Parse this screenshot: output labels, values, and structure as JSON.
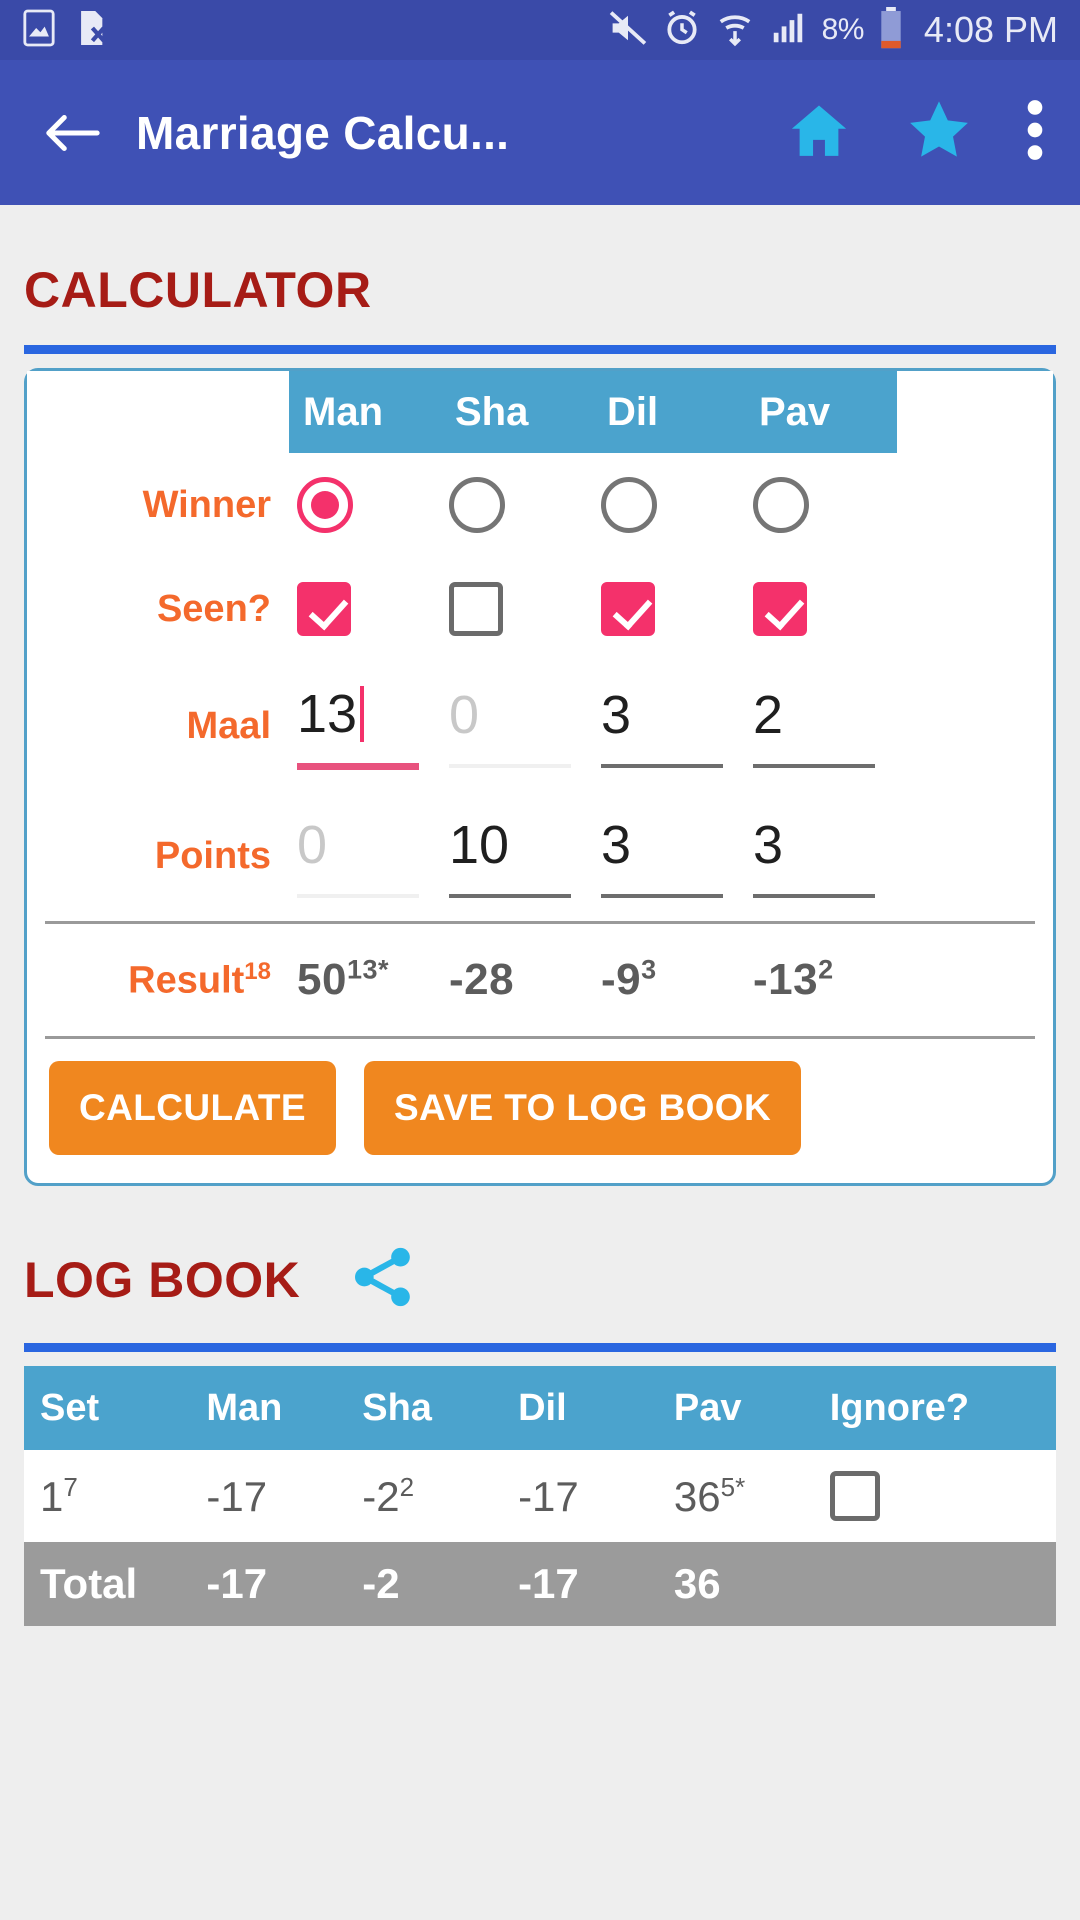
{
  "statusbar": {
    "battery_percent": "8%",
    "time": "4:08 PM",
    "icons": [
      "image-icon",
      "sim-card-error-icon",
      "mute-icon",
      "alarm-icon",
      "wifi-icon",
      "signal-icon",
      "battery-icon"
    ]
  },
  "appbar": {
    "title": "Marriage Calcu...",
    "back_icon": "back-arrow-icon",
    "home_icon": "home-icon",
    "star_icon": "star-icon",
    "overflow_icon": "more-vert-icon"
  },
  "calculator": {
    "heading": "CALCULATOR",
    "columns": [
      "Man",
      "Sha",
      "Dil",
      "Pav"
    ],
    "rows": {
      "winner": {
        "label": "Winner",
        "selected_index": 0,
        "values": [
          true,
          false,
          false,
          false
        ]
      },
      "seen": {
        "label": "Seen?",
        "values": [
          true,
          false,
          true,
          true
        ]
      },
      "maal": {
        "label": "Maal",
        "values": [
          "13",
          "",
          "3",
          "2"
        ],
        "placeholders": [
          "0",
          "0",
          "0",
          "0"
        ],
        "focused_index": 0
      },
      "points": {
        "label": "Points",
        "values": [
          "",
          "10",
          "3",
          "3"
        ],
        "placeholders": [
          "0",
          "0",
          "0",
          "0"
        ],
        "focused_index": -1
      },
      "result": {
        "label": "Result",
        "label_sup": "18",
        "values": [
          {
            "main": "50",
            "sup": "13*"
          },
          {
            "main": "-28",
            "sup": ""
          },
          {
            "main": "-9",
            "sup": "3"
          },
          {
            "main": "-13",
            "sup": "2"
          }
        ]
      }
    },
    "calculate_button": "CALCULATE",
    "save_button": "SAVE TO LOG BOOK"
  },
  "logbook": {
    "heading": "LOG BOOK",
    "share_icon": "share-icon",
    "columns": [
      "Set",
      "Man",
      "Sha",
      "Dil",
      "Pav",
      "Ignore?"
    ],
    "rows": [
      {
        "set": {
          "main": "1",
          "sup": "7"
        },
        "cells": [
          {
            "main": "-17",
            "sup": ""
          },
          {
            "main": "-2",
            "sup": "2"
          },
          {
            "main": "-17",
            "sup": ""
          },
          {
            "main": "36",
            "sup": "5*"
          }
        ],
        "ignore": false
      }
    ],
    "total": {
      "label": "Total",
      "values": [
        "-17",
        "-2",
        "-17",
        "36"
      ]
    }
  },
  "colors": {
    "statusbar": "#3a4aa8",
    "appbar": "#3f51b5",
    "accent_cyan": "#29b6e8",
    "heading_red": "#a61c16",
    "rule_blue": "#2a66e0",
    "table_header": "#4ba3cd",
    "label_orange": "#f4692c",
    "button_orange": "#f0871f",
    "checked_pink": "#f4316b",
    "total_grey": "#9b9b9b"
  }
}
